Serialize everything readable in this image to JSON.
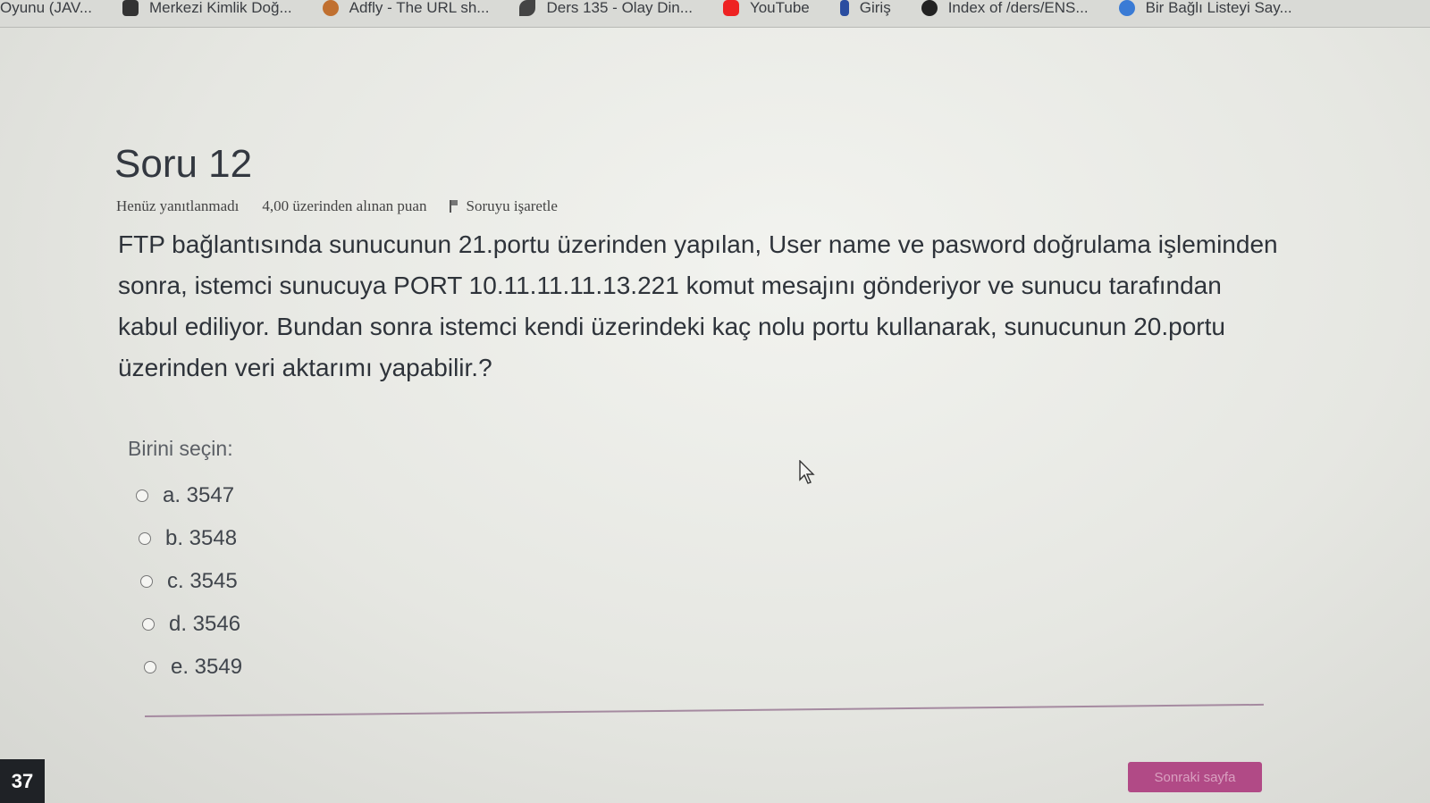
{
  "bookmarks": [
    {
      "label": "Oyunu (JAV...",
      "icon": "app-icon"
    },
    {
      "label": "Merkezi Kimlik Doğ...",
      "icon": "id-icon"
    },
    {
      "label": "Adfly - The URL sh...",
      "icon": "bird-icon"
    },
    {
      "label": "Ders 135 - Olay Din...",
      "icon": "leaf-icon"
    },
    {
      "label": "YouTube",
      "icon": "youtube-icon"
    },
    {
      "label": "Giriş",
      "icon": "info-icon"
    },
    {
      "label": "Index of /ders/ENS...",
      "icon": "globe-icon"
    },
    {
      "label": "Bir Bağlı Listeyi Say...",
      "icon": "blue-globe-icon"
    }
  ],
  "question": {
    "title": "Soru 12",
    "status": "Henüz yanıtlanmadı",
    "points": "4,00 üzerinden alınan puan",
    "flag_label": "Soruyu işaretle",
    "text": "FTP bağlantısında sunucunun 21.portu üzerinden yapılan, User name ve pasword doğrulama işleminden sonra, istemci sunucuya PORT 10.11.11.11.13.221 komut mesajını gönderiyor ve sunucu tarafından kabul ediliyor. Bundan sonra istemci kendi üzerindeki kaç nolu portu kullanarak, sunucunun 20.portu üzerinden veri aktarımı yapabilir.?",
    "prompt": "Birini seçin:",
    "answers": [
      "a. 3547",
      "b. 3548",
      "c. 3545",
      "d. 3546",
      "e. 3549"
    ]
  },
  "footer": {
    "next_label": "Sonraki sayfa",
    "page_number": "37"
  },
  "colors": {
    "accent": "#b14a86",
    "divider": "#a58aa0"
  }
}
